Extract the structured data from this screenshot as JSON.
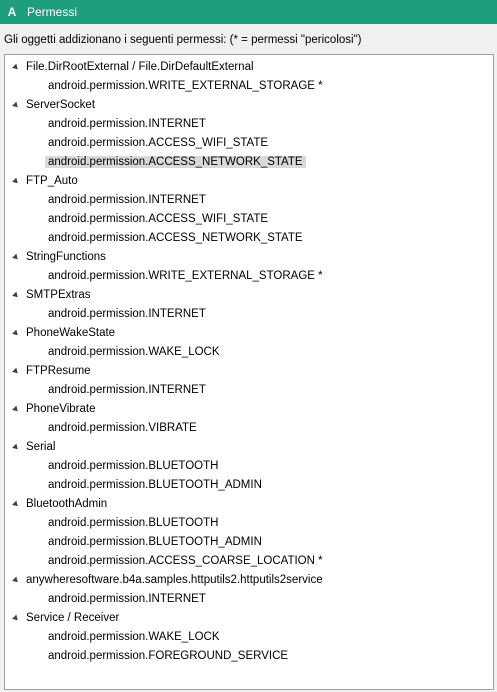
{
  "window": {
    "title": "Permessi",
    "icon": "A"
  },
  "description": "Gli oggetti addizionano i seguenti permessi: (* = permessi \"pericolosi\")",
  "tree": [
    {
      "label": "File.DirRootExternal / File.DirDefaultExternal",
      "children": [
        "android.permission.WRITE_EXTERNAL_STORAGE *"
      ]
    },
    {
      "label": "ServerSocket",
      "children": [
        "android.permission.INTERNET",
        "android.permission.ACCESS_WIFI_STATE",
        "android.permission.ACCESS_NETWORK_STATE"
      ]
    },
    {
      "label": "FTP_Auto",
      "children": [
        "android.permission.INTERNET",
        "android.permission.ACCESS_WIFI_STATE",
        "android.permission.ACCESS_NETWORK_STATE"
      ]
    },
    {
      "label": "StringFunctions",
      "children": [
        "android.permission.WRITE_EXTERNAL_STORAGE *"
      ]
    },
    {
      "label": "SMTPExtras",
      "children": [
        "android.permission.INTERNET"
      ]
    },
    {
      "label": "PhoneWakeState",
      "children": [
        "android.permission.WAKE_LOCK"
      ]
    },
    {
      "label": "FTPResume",
      "children": [
        "android.permission.INTERNET"
      ]
    },
    {
      "label": "PhoneVibrate",
      "children": [
        "android.permission.VIBRATE"
      ]
    },
    {
      "label": "Serial",
      "children": [
        "android.permission.BLUETOOTH",
        "android.permission.BLUETOOTH_ADMIN"
      ]
    },
    {
      "label": "BluetoothAdmin",
      "children": [
        "android.permission.BLUETOOTH",
        "android.permission.BLUETOOTH_ADMIN",
        "android.permission.ACCESS_COARSE_LOCATION *"
      ]
    },
    {
      "label": "anywheresoftware.b4a.samples.httputils2.httputils2service",
      "children": [
        "android.permission.INTERNET"
      ]
    },
    {
      "label": "Service / Receiver",
      "children": [
        "android.permission.WAKE_LOCK",
        "android.permission.FOREGROUND_SERVICE"
      ]
    }
  ],
  "selected": {
    "node": 1,
    "child": 2
  }
}
